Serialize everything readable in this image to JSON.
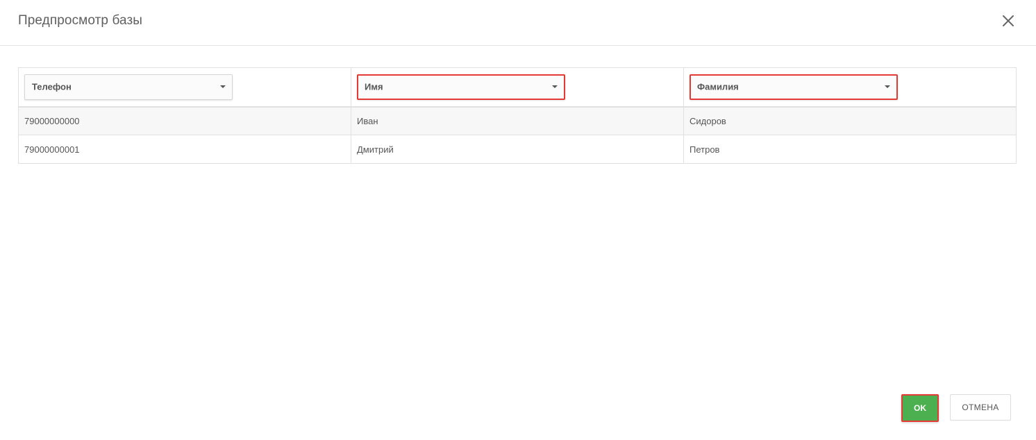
{
  "dialog": {
    "title": "Предпросмотр базы",
    "close_icon": "close-icon"
  },
  "columns": [
    {
      "label": "Телефон",
      "highlighted": false
    },
    {
      "label": "Имя",
      "highlighted": true
    },
    {
      "label": "Фамилия",
      "highlighted": true
    }
  ],
  "rows": [
    [
      "79000000000",
      "Иван",
      "Сидоров"
    ],
    [
      "79000000001",
      "Дмитрий",
      "Петров"
    ]
  ],
  "footer": {
    "ok_label": "OK",
    "cancel_label": "ОТМЕНА"
  },
  "colors": {
    "accent_green": "#4caf50",
    "highlight_red": "#e53935",
    "border": "#e0e0e0"
  }
}
